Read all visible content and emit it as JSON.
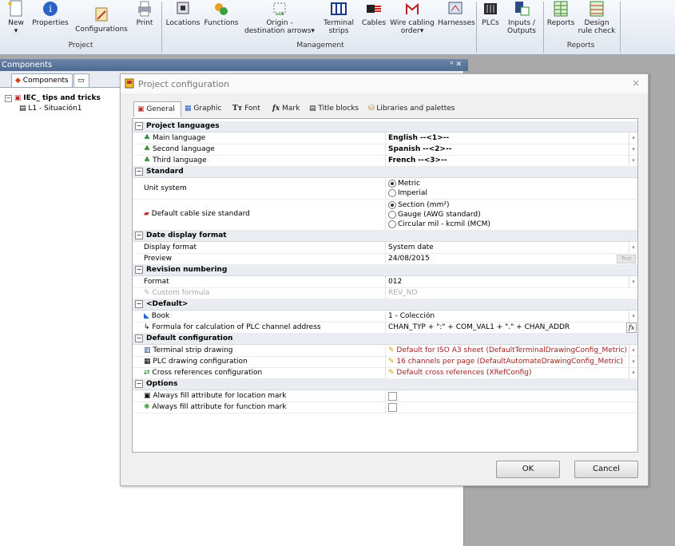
{
  "ribbon": {
    "buttons": [
      {
        "label": "New\n▾"
      },
      {
        "label": "Properties"
      },
      {
        "label": "Configurations"
      },
      {
        "label": "Print"
      },
      {
        "label": "Locations"
      },
      {
        "label": "Functions"
      },
      {
        "label": "Origin -\ndestination arrows▾"
      },
      {
        "label": "Terminal\nstrips"
      },
      {
        "label": "Cables"
      },
      {
        "label": "Wire cabling\norder▾"
      },
      {
        "label": "Harnesses"
      },
      {
        "label": "PLCs"
      },
      {
        "label": "Inputs /\nOutputs"
      },
      {
        "label": "Reports"
      },
      {
        "label": "Design\nrule check"
      }
    ],
    "groups": [
      "Project",
      "Management",
      "Reports"
    ]
  },
  "components": {
    "title": "Components",
    "pin": "ᵖ ✕",
    "tab": "Components",
    "tree_root": "IEC_ tips and tricks",
    "tree_child": "L1 - Situación1"
  },
  "dialog": {
    "title": "Project configuration",
    "close": "×",
    "tabs": [
      "General",
      "Graphic",
      "Font",
      "Mark",
      "Title blocks",
      "Libraries and palettes"
    ],
    "sections": {
      "languages": "Project languages",
      "standard": "Standard",
      "date": "Date display format",
      "revision": "Revision numbering",
      "default": "<Default>",
      "default_config": "Default configuration",
      "options": "Options"
    },
    "rows": {
      "main_language": {
        "name": "Main language",
        "value": "English",
        "suffix": "--<1>--"
      },
      "second_language": {
        "name": "Second language",
        "value": "Spanish",
        "suffix": "--<2>--"
      },
      "third_language": {
        "name": "Third language",
        "value": "French",
        "suffix": "--<3>--"
      },
      "unit_system": {
        "name": "Unit system",
        "options": [
          "Metric",
          "Imperial"
        ],
        "selected": "Metric"
      },
      "cable_size": {
        "name": "Default cable size standard",
        "options": [
          "Section (mm²)",
          "Gauge (AWG standard)",
          "Circular mil - kcmil (MCM)"
        ],
        "selected": "Section (mm²)"
      },
      "display_format": {
        "name": "Display format",
        "value": "System date"
      },
      "preview": {
        "name": "Preview",
        "value": "24/08/2015",
        "test": "Test"
      },
      "format": {
        "name": "Format",
        "value": "012"
      },
      "custom_formula": {
        "name": "Custom formula",
        "value": "REV_NO"
      },
      "book": {
        "name": "Book",
        "value": "1 - Colección"
      },
      "plc_formula": {
        "name": "Formula for calculation of PLC channel address",
        "value": "CHAN_TYP + \":\" + COM_VAL1 + \".\" + CHAN_ADDR",
        "fx": "fx"
      },
      "terminal_drawing": {
        "name": "Terminal strip drawing",
        "value": "Default for ISO A3 sheet (DefaultTerminalDrawingConfig_Metric)"
      },
      "plc_drawing": {
        "name": "PLC drawing configuration",
        "value": "16 channels per page (DefaultAutomateDrawingConfig_Metric)"
      },
      "crossref": {
        "name": "Cross references configuration",
        "value": "Default cross references (XRefConfig)"
      },
      "location_mark": {
        "name": "Always fill attribute for location mark",
        "checked": false
      },
      "function_mark": {
        "name": "Always fill attribute for function mark",
        "checked": false
      }
    },
    "ok": "OK",
    "cancel": "Cancel"
  },
  "colors": {
    "accent": "#4f6b91",
    "link_red": "#a02020"
  }
}
